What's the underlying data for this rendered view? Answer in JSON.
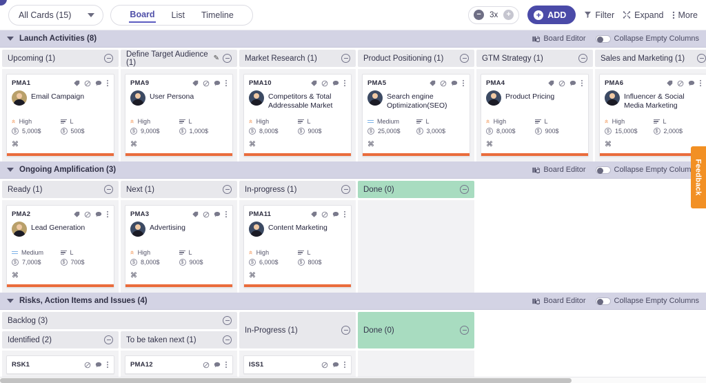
{
  "toolbar": {
    "all_cards_label": "All Cards (15)",
    "views": [
      {
        "label": "Board",
        "active": true
      },
      {
        "label": "List",
        "active": false
      },
      {
        "label": "Timeline",
        "active": false
      }
    ],
    "zoom_level": "3x",
    "zoom_out_symbol": "−",
    "zoom_in_symbol": "+",
    "add_label": "ADD",
    "add_symbol": "+",
    "filter_label": "Filter",
    "expand_label": "Expand",
    "more_label": "More"
  },
  "lane_actions": {
    "board_editor_label": "Board Editor",
    "collapse_label": "Collapse Empty Columns"
  },
  "feedback_label": "Feedback",
  "swimlanes": [
    {
      "title": "Launch Activities (8)",
      "columns": [
        {
          "title": "Upcoming (1)",
          "editable": false,
          "done": false,
          "cards": [
            {
              "id": "PMA1",
              "title": "Email Campaign",
              "avatar": "a2",
              "priority": "High",
              "priority_level": "high",
              "size": "L",
              "budget": "5,000$",
              "cost": "500$",
              "icons": [
                "tag-icon",
                "blocked-icon",
                "comment-icon",
                "kebab-icon"
              ]
            }
          ]
        },
        {
          "title": "Define Target Audience (1)",
          "editable": true,
          "done": false,
          "cards": [
            {
              "id": "PMA9",
              "title": "User Persona",
              "avatar": "a1",
              "priority": "High",
              "priority_level": "high",
              "size": "L",
              "budget": "9,000$",
              "cost": "1,000$",
              "icons": [
                "tag-icon",
                "blocked-icon",
                "comment-icon",
                "kebab-icon"
              ]
            }
          ]
        },
        {
          "title": "Market Research (1)",
          "editable": false,
          "done": false,
          "cards": [
            {
              "id": "PMA10",
              "title": "Competitors & Total Addressable Market",
              "avatar": "a1",
              "priority": "High",
              "priority_level": "high",
              "size": "L",
              "budget": "8,000$",
              "cost": "900$",
              "icons": [
                "tag-icon",
                "blocked-icon",
                "comment-icon",
                "kebab-icon"
              ]
            }
          ]
        },
        {
          "title": "Product Positioning (1)",
          "editable": false,
          "done": false,
          "cards": [
            {
              "id": "PMA5",
              "title": "Search engine Optimization(SEO)",
              "avatar": "a1",
              "priority": "Medium",
              "priority_level": "medium",
              "size": "L",
              "budget": "25,000$",
              "cost": "3,000$",
              "icons": [
                "tag-icon",
                "blocked-icon",
                "comment-icon",
                "kebab-icon"
              ]
            }
          ]
        },
        {
          "title": "GTM Strategy (1)",
          "editable": false,
          "done": false,
          "cards": [
            {
              "id": "PMA4",
              "title": "Product Pricing",
              "avatar": "a1",
              "priority": "High",
              "priority_level": "high",
              "size": "L",
              "budget": "8,000$",
              "cost": "900$",
              "icons": [
                "tag-icon",
                "blocked-icon",
                "comment-icon",
                "kebab-icon"
              ]
            }
          ]
        },
        {
          "title": "Sales and Marketing (1)",
          "editable": false,
          "done": false,
          "cards": [
            {
              "id": "PMA6",
              "title": "Influencer & Social Media Marketing",
              "avatar": "a1",
              "priority": "High",
              "priority_level": "high",
              "size": "L",
              "budget": "15,000$",
              "cost": "2,000$",
              "icons": [
                "tag-icon",
                "blocked-icon",
                "comment-icon",
                "kebab-icon"
              ]
            }
          ]
        }
      ]
    },
    {
      "title": "Ongoing Amplification (3)",
      "columns": [
        {
          "title": "Ready (1)",
          "editable": false,
          "done": false,
          "cards": [
            {
              "id": "PMA2",
              "title": "Lead Generation",
              "avatar": "a2",
              "priority": "Medium",
              "priority_level": "medium",
              "size": "L",
              "budget": "7,000$",
              "cost": "700$",
              "icons": [
                "tag-icon",
                "blocked-icon",
                "comment-icon",
                "kebab-icon"
              ]
            }
          ]
        },
        {
          "title": "Next (1)",
          "editable": false,
          "done": false,
          "cards": [
            {
              "id": "PMA3",
              "title": "Advertising",
              "avatar": "a1",
              "priority": "High",
              "priority_level": "high",
              "size": "L",
              "budget": "8,000$",
              "cost": "900$",
              "icons": [
                "tag-icon",
                "blocked-icon",
                "comment-icon",
                "kebab-icon"
              ]
            }
          ]
        },
        {
          "title": "In-progress (1)",
          "editable": false,
          "done": false,
          "cards": [
            {
              "id": "PMA11",
              "title": "Content Marketing",
              "avatar": "a1",
              "priority": "High",
              "priority_level": "high",
              "size": "L",
              "budget": "6,000$",
              "cost": "800$",
              "icons": [
                "tag-icon",
                "blocked-icon",
                "comment-icon",
                "kebab-icon"
              ]
            }
          ]
        },
        {
          "title": "Done (0)",
          "editable": false,
          "done": true,
          "cards": []
        }
      ]
    },
    {
      "title": "Risks, Action Items and Issues (4)",
      "group": {
        "parent_title": "Backlog (3)",
        "sub_columns": [
          {
            "title": "Identified (2)",
            "done": false,
            "cards": [
              {
                "id": "RSK1",
                "icons": [
                  "blocked-icon",
                  "comment-icon",
                  "kebab-icon"
                ]
              }
            ]
          },
          {
            "title": "To be taken next (1)",
            "done": false,
            "cards": [
              {
                "id": "PMA12",
                "icons": [
                  "blocked-icon",
                  "comment-icon",
                  "kebab-icon"
                ]
              }
            ]
          }
        ]
      },
      "columns": [
        {
          "title": "In-Progress (1)",
          "editable": false,
          "done": false,
          "tall": true,
          "cards": [
            {
              "id": "ISS1",
              "icons": [
                "blocked-icon",
                "comment-icon",
                "kebab-icon"
              ]
            }
          ]
        },
        {
          "title": "Done (0)",
          "editable": false,
          "done": true,
          "tall": true,
          "cards": []
        }
      ]
    }
  ],
  "colors": {
    "accent": "#4a4aa8",
    "card_accent": "#ea6c3c",
    "lane_header": "#d3d3e4",
    "done_column": "#a8dcc0",
    "feedback": "#f29024",
    "priority_high": "#f08c48",
    "priority_medium": "#7fb3e8"
  }
}
